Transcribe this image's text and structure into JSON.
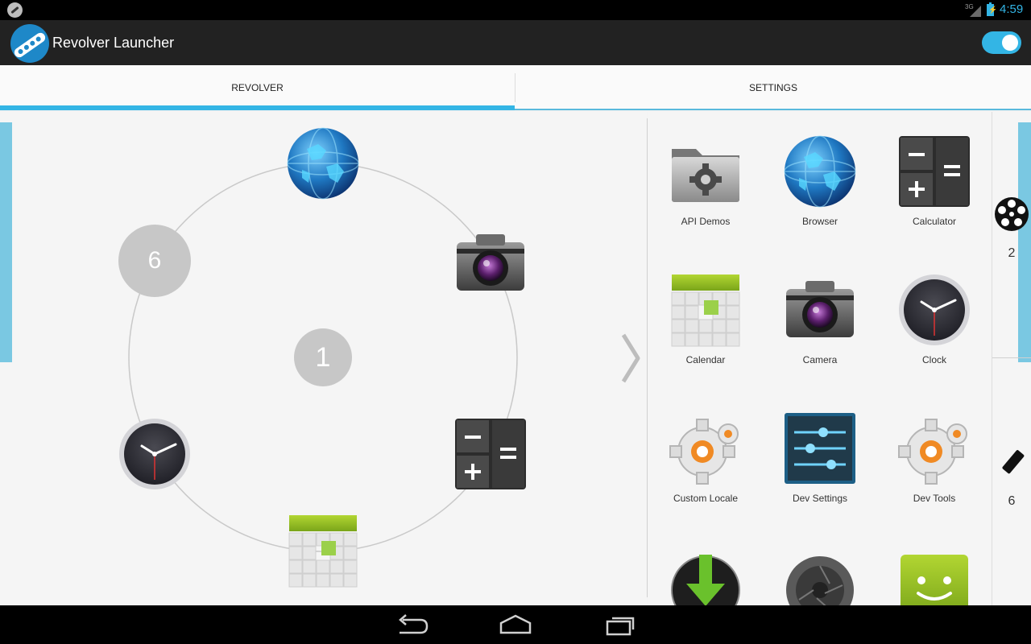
{
  "status_bar": {
    "time": "4:59",
    "network": "3G"
  },
  "action_bar": {
    "title": "Revolver Launcher",
    "toggle_on": true
  },
  "tabs": [
    {
      "label": "REVOLVER",
      "selected": true
    },
    {
      "label": "SETTINGS",
      "selected": false
    }
  ],
  "revolver": {
    "center_number": "1",
    "slot_number": "6",
    "slots": [
      "browser-icon",
      "camera-icon",
      "calculator-icon",
      "calendar-icon",
      "clock-icon"
    ]
  },
  "apps": [
    {
      "label": "API Demos",
      "icon": "folder-gear-icon"
    },
    {
      "label": "Browser",
      "icon": "globe-icon"
    },
    {
      "label": "Calculator",
      "icon": "calculator-icon"
    },
    {
      "label": "Calendar",
      "icon": "calendar-icon"
    },
    {
      "label": "Camera",
      "icon": "camera-icon"
    },
    {
      "label": "Clock",
      "icon": "clock-icon"
    },
    {
      "label": "Custom Locale",
      "icon": "orange-gear-icon"
    },
    {
      "label": "Dev Settings",
      "icon": "sliders-icon"
    },
    {
      "label": "Dev Tools",
      "icon": "orange-gear-icon"
    },
    {
      "label": "",
      "icon": "download-icon"
    },
    {
      "label": "",
      "icon": "shutter-icon"
    },
    {
      "label": "",
      "icon": "messaging-icon"
    }
  ],
  "rail": [
    {
      "icon": "revolver-cylinder-icon",
      "count": "2"
    },
    {
      "icon": "bullet-icon",
      "count": "6"
    }
  ],
  "colors": {
    "accent": "#33b5e5",
    "accent_light": "#7ac8e2",
    "action_bar": "#222222"
  }
}
